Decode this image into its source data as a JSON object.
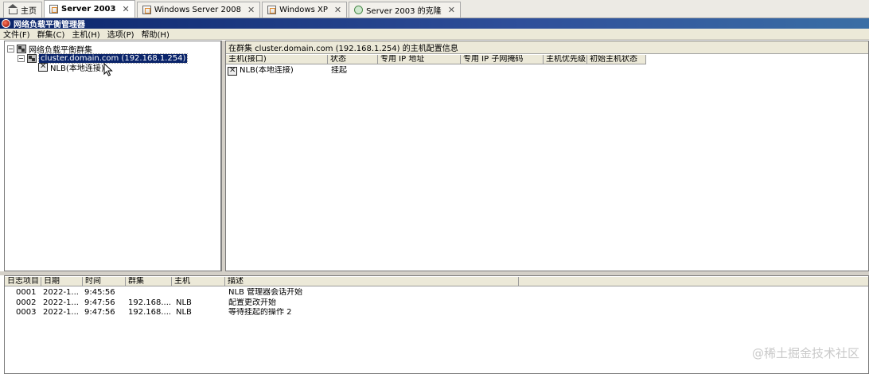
{
  "tabs": [
    {
      "label": "主页",
      "icon": "home-icon",
      "active": false,
      "closable": false
    },
    {
      "label": "Server 2003",
      "icon": "vm-icon",
      "active": true,
      "closable": true
    },
    {
      "label": "Windows Server 2008",
      "icon": "vm-icon",
      "active": false,
      "closable": true
    },
    {
      "label": "Windows XP",
      "icon": "vm-icon",
      "active": false,
      "closable": true
    },
    {
      "label": "Server 2003 的克隆",
      "icon": "clone-icon",
      "active": false,
      "closable": true
    }
  ],
  "tab_close_glyph": "✕",
  "title": "网络负载平衡管理器",
  "menu": [
    "文件(F)",
    "群集(C)",
    "主机(H)",
    "选项(P)",
    "帮助(H)"
  ],
  "tree": {
    "root": "网络负载平衡群集",
    "cluster": "cluster.domain.com (192.168.1.254)",
    "host": "NLB(本地连接)"
  },
  "right": {
    "header": "在群集 cluster.domain.com (192.168.1.254) 的主机配置信息",
    "columns": [
      "主机(接口)",
      "状态",
      "专用 IP 地址",
      "专用 IP 子网掩码",
      "主机优先级",
      "初始主机状态"
    ],
    "rows": [
      {
        "host": "NLB(本地连接)",
        "status": "挂起"
      }
    ]
  },
  "log": {
    "columns": [
      "日志项目",
      "日期",
      "时间",
      "群集",
      "主机",
      "描述"
    ],
    "rows": [
      {
        "id": "0001",
        "date": "2022-1...",
        "time": "9:45:56",
        "cluster": "",
        "host": "",
        "desc": "NLB 管理器会话开始"
      },
      {
        "id": "0002",
        "date": "2022-1...",
        "time": "9:47:56",
        "cluster": "192.168....",
        "host": "NLB",
        "desc": "配置更改开始"
      },
      {
        "id": "0003",
        "date": "2022-1...",
        "time": "9:47:56",
        "cluster": "192.168....",
        "host": "NLB",
        "desc": "等待挂起的操作 2"
      }
    ]
  },
  "watermark": "@稀土掘金技术社区"
}
